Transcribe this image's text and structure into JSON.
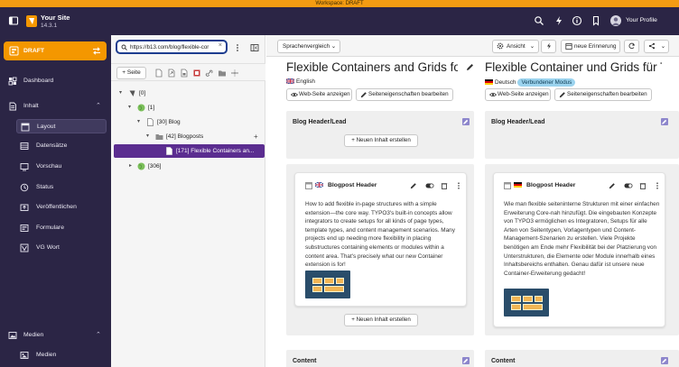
{
  "workspace": {
    "label": "Workspace: DRAFT"
  },
  "topbar": {
    "site_name": "Your Site",
    "version": "14.3.1",
    "profile_label": "Your Profile",
    "icons": [
      "sidebar-toggle-icon",
      "search-icon",
      "flash-icon",
      "info-icon",
      "bookmark-icon",
      "help-icon",
      "user-avatar-icon"
    ]
  },
  "workspace_selector": {
    "label": "DRAFT"
  },
  "modules": {
    "dashboard": "Dashboard",
    "content_group": "Inhalt",
    "layout": "Layout",
    "records": "Datensätze",
    "preview": "Vorschau",
    "status": "Status",
    "publish": "Veröffentlichen",
    "forms": "Formulare",
    "vg_wort": "VG Wort",
    "media_group": "Medien",
    "media": "Medien"
  },
  "tree": {
    "search_value": "https://b13.com/blog/flexible-cor",
    "new_page_label": "Seite",
    "nodes": {
      "root": "[0]",
      "site": "[1]",
      "blog": "[30] Blog",
      "blogposts": "[42] Blogposts",
      "selected": "[171] Flexible Containers an...",
      "other": "[306]"
    }
  },
  "docheader": {
    "compare_label": "Sprachenvergleich",
    "view_label": "Ansicht",
    "reminder_label": "neue Erinnerung"
  },
  "columns": {
    "en": {
      "title": "Flexible Containers and Grids for ...",
      "language": "English",
      "view_label": "Web-Seite anzeigen",
      "edit_label": "Seiteneigenschaften bearbeiten",
      "section_header": "Blog Header/Lead",
      "add_label": "Neuen Inhalt erstellen",
      "card_title": "Blogpost Header",
      "card_text": "How to add flexible in-page structures with a simple extension—the core way. TYPO3's built-in concepts allow integrators to create setups for all kinds of page types, template types, and content management scenarios. Many projects end up needing more flexibility in placing substructures containing elements or modules within a content area. That's precisely what our new Container extension is for!",
      "section_content": "Content"
    },
    "de": {
      "title": "Flexible Container und Grids für T...",
      "language": "Deutsch",
      "mode_badge": "Verbundener Modus",
      "view_label": "Web-Seite anzeigen",
      "edit_label": "Seiteneigenschaften bearbeiten",
      "section_header": "Blog Header/Lead",
      "card_title": "Blogpost Header",
      "card_text": "Wie man flexible seiteninterne Strukturen mit einer einfachen Erweiterung Core-nah hinzufügt. Die eingebauten Konzepte von TYPO3 ermöglichen es Integratoren, Setups für alle Arten von Seitentypen, Vorlagentypen und Content-Management-Szenarien zu erstellen. Viele Projekte benötigen am Ende mehr Flexibilität bei der Platzierung von Unterstrukturen, die Elemente oder Module innerhalb eines Inhaltsbereichs enthalten. Genau dafür ist unsere neue Container-Erweiterung gedacht!",
      "section_content": "Content"
    }
  },
  "colors": {
    "topbar": "#2b2545",
    "workspace_bar": "#f39c12",
    "accent_orange": "#f49700",
    "tree_selected": "#5b2d90",
    "badge": "#9bd3ee"
  }
}
